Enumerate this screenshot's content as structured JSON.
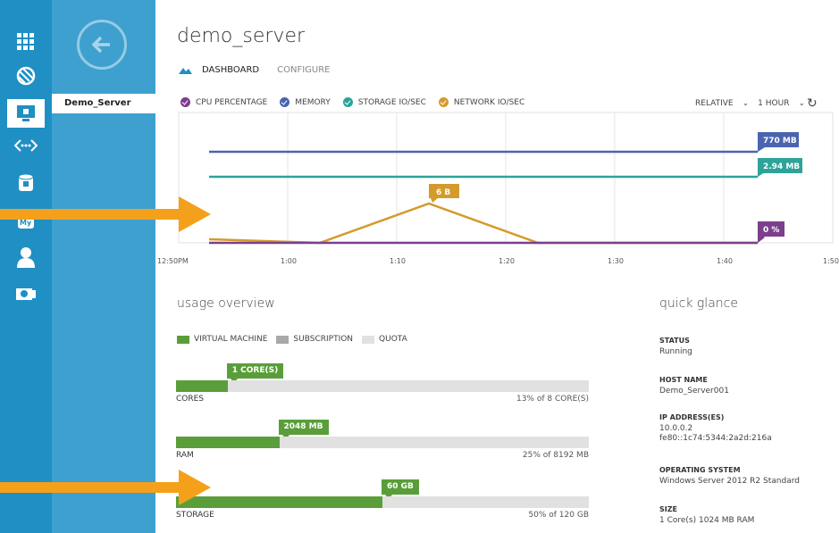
{
  "page": {
    "title": "demo_server",
    "tabs": [
      {
        "label": "DASHBOARD",
        "active": true
      },
      {
        "label": "CONFIGURE",
        "active": false
      }
    ]
  },
  "nav": {
    "rail_icons": [
      "grid-icon",
      "globe-icon",
      "virtual-machine-icon",
      "network-icon",
      "database-icon",
      "mysql-icon",
      "user-icon",
      "media-icon"
    ],
    "panel_item": "Demo_Server"
  },
  "chart": {
    "legend": [
      {
        "label": "CPU PERCENTAGE",
        "color": "#7b3f8c"
      },
      {
        "label": "MEMORY",
        "color": "#4a64b0"
      },
      {
        "label": "STORAGE IO/SEC",
        "color": "#2da39a"
      },
      {
        "label": "NETWORK IO/SEC",
        "color": "#d49a2c"
      }
    ],
    "mode": "RELATIVE",
    "range": "1 HOUR"
  },
  "chart_data": {
    "type": "line",
    "x": [
      "12:50PM",
      "1:00",
      "1:10",
      "1:20",
      "1:30",
      "1:40",
      "1:50"
    ],
    "series": [
      {
        "name": "MEMORY",
        "end_label": "770 MB",
        "color": "#4a64b0"
      },
      {
        "name": "STORAGE IO/SEC",
        "end_label": "2.94 MB",
        "color": "#2da39a"
      },
      {
        "name": "NETWORK IO/SEC",
        "peak_label": "6 B",
        "color": "#d49a2c"
      },
      {
        "name": "CPU PERCENTAGE",
        "end_label": "0 %",
        "color": "#7b3f8c"
      }
    ]
  },
  "usage": {
    "title": "usage overview",
    "legend": [
      {
        "label": "VIRTUAL MACHINE",
        "color": "#5a9e3a"
      },
      {
        "label": "SUBSCRIPTION",
        "color": "#a9a9a9"
      },
      {
        "label": "QUOTA",
        "color": "#e1e1e1"
      }
    ],
    "bars": [
      {
        "name": "CORES",
        "tag": "1 CORE(S)",
        "summary": "13% of 8 CORE(S)",
        "fraction": 0.125
      },
      {
        "name": "RAM",
        "tag": "2048 MB",
        "summary": "25% of 8192 MB",
        "fraction": 0.25
      },
      {
        "name": "STORAGE",
        "tag": "60 GB",
        "summary": "50% of 120 GB",
        "fraction": 0.5
      }
    ]
  },
  "quick_glance": {
    "title": "quick glance",
    "items": [
      {
        "label": "STATUS",
        "value": "Running"
      },
      {
        "label": "HOST NAME",
        "value": "Demo_Server001"
      },
      {
        "label": "IP ADDRESS(ES)",
        "value": "10.0.0.2\nfe80::1c74:5344:2a2d:216a"
      },
      {
        "label": "OPERATING SYSTEM",
        "value": "Windows Server 2012 R2 Standard"
      },
      {
        "label": "SIZE",
        "value": "1 Core(s) 1024 MB RAM"
      }
    ]
  },
  "colors": {
    "rail": "#1f8fc4",
    "panel": "#3ea0cf",
    "accent_arrow": "#f5a01a",
    "usage_fill": "#5a9e3a"
  }
}
